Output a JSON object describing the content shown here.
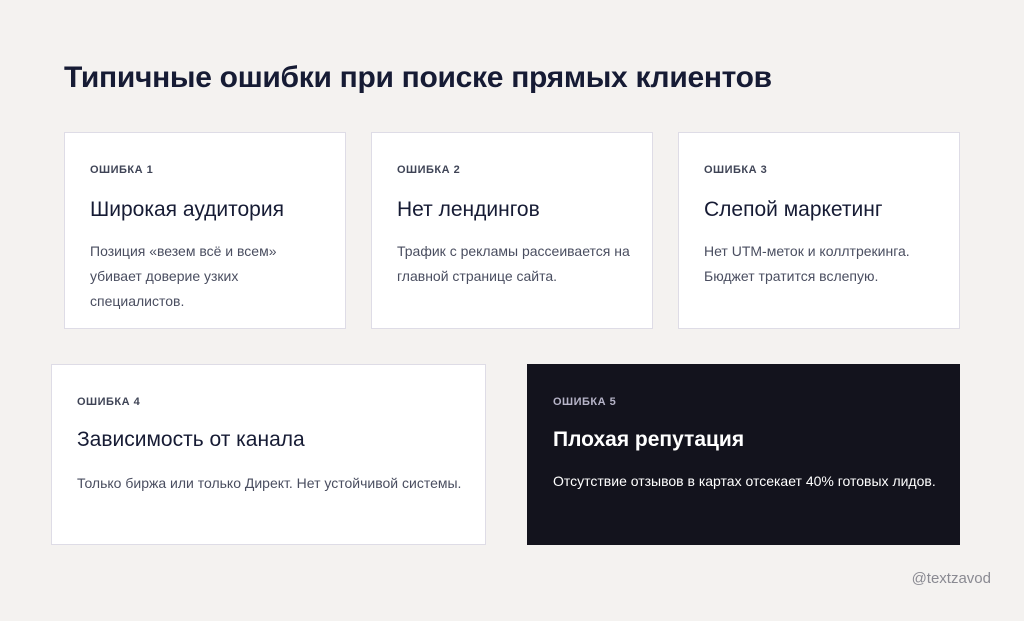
{
  "title": "Типичные ошибки при поиске прямых клиентов",
  "cards": [
    {
      "label": "ОШИБКА 1",
      "heading": "Широкая аудитория",
      "text": "Позиция «везем всё и всем» убивает доверие узких специалистов."
    },
    {
      "label": "ОШИБКА 2",
      "heading": "Нет лендингов",
      "text": "Трафик с рекламы рассеивается на главной странице сайта."
    },
    {
      "label": "ОШИБКА 3",
      "heading": "Слепой маркетинг",
      "text": "Нет UTM-меток и коллтрекинга. Бюджет тратится вслепую."
    },
    {
      "label": "ОШИБКА 4",
      "heading": "Зависимость от канала",
      "text": "Только биржа или только Директ. Нет устойчивой системы."
    },
    {
      "label": "ОШИБКА 5",
      "heading": "Плохая репутация",
      "text": "Отсутствие отзывов в картах отсекает 40% готовых лидов."
    }
  ],
  "watermark": "@textzavod",
  "colors": {
    "background": "#f4f2f0",
    "card": "#ffffff",
    "dark_card": "#13131d",
    "title": "#161b34"
  }
}
